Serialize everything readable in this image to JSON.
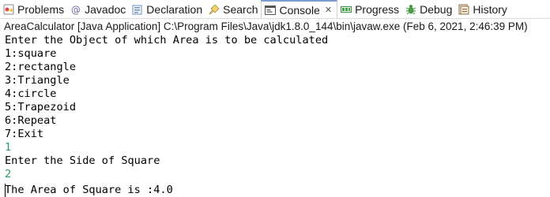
{
  "tabs": [
    {
      "label": "Problems",
      "icon": "problems-icon",
      "active": false
    },
    {
      "label": "Javadoc",
      "icon": "javadoc-icon",
      "active": false
    },
    {
      "label": "Declaration",
      "icon": "declaration-icon",
      "active": false
    },
    {
      "label": "Search",
      "icon": "search-icon",
      "active": false
    },
    {
      "label": "Console",
      "icon": "console-icon",
      "active": true,
      "close": "✕"
    },
    {
      "label": "Progress",
      "icon": "progress-icon",
      "active": false
    },
    {
      "label": "Debug",
      "icon": "debug-icon",
      "active": false
    },
    {
      "label": "History",
      "icon": "history-icon",
      "active": false
    }
  ],
  "console": {
    "description": "AreaCalculator [Java Application] C:\\Program Files\\Java\\jdk1.8.0_144\\bin\\javaw.exe (Feb 6, 2021, 2:46:39 PM)",
    "lines": [
      {
        "text": "Enter the Object of which Area is to be calculated",
        "kind": "output"
      },
      {
        "text": "1:square",
        "kind": "output"
      },
      {
        "text": "2:rectangle",
        "kind": "output"
      },
      {
        "text": "3:Triangle",
        "kind": "output"
      },
      {
        "text": "4:circle",
        "kind": "output"
      },
      {
        "text": "5:Trapezoid",
        "kind": "output"
      },
      {
        "text": "6:Repeat",
        "kind": "output"
      },
      {
        "text": "7:Exit",
        "kind": "output"
      },
      {
        "text": "1",
        "kind": "input"
      },
      {
        "text": "Enter the Side of Square",
        "kind": "output"
      },
      {
        "text": "2",
        "kind": "input"
      },
      {
        "text": "The Area of Square is :4.0",
        "kind": "output"
      }
    ]
  },
  "colors": {
    "input_text": "#22a065",
    "output_text": "#000000",
    "active_tab_accent": "#7a9ecf"
  }
}
